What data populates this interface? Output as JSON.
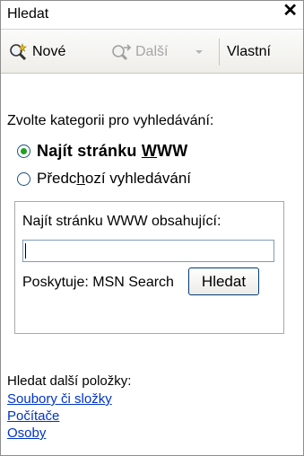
{
  "window": {
    "title": "Hledat",
    "close_glyph": "✕"
  },
  "toolbar": {
    "new_label": "Nové",
    "new_icon": "magnifier-new-icon",
    "next_label": "Další",
    "next_icon": "magnifier-next-icon",
    "next_enabled": false,
    "custom_label": "Vlastní"
  },
  "search": {
    "prompt": "Zvolte kategorii pro vyhledávání:",
    "options": [
      {
        "label_pre": "Najít stránku ",
        "label_accel": "W",
        "label_post": "WW",
        "selected": true
      },
      {
        "label_pre": "Předc",
        "label_accel": "h",
        "label_post": "ozí vyhledávání",
        "selected": false
      }
    ],
    "box": {
      "field_label": "Najít stránku WWW obsahující:",
      "field_value": "",
      "provider_text": "Poskytuje: MSN Search",
      "button_label": "Hledat"
    }
  },
  "more": {
    "heading": "Hledat další položky:",
    "links": [
      {
        "label": "Soubory či složky"
      },
      {
        "label": "Počítače"
      },
      {
        "label": "Osoby"
      }
    ]
  },
  "colors": {
    "link": "#0033cc",
    "radio_dot": "#21a121",
    "border": "#a9a9a9"
  }
}
